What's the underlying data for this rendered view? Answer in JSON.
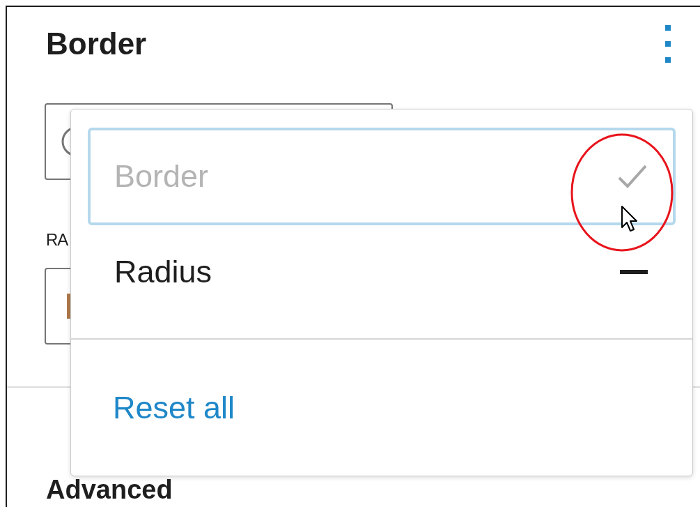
{
  "panel": {
    "title": "Border",
    "fields": [
      {
        "kind": "circle"
      },
      {
        "kind": "swatch"
      }
    ],
    "label": "RA",
    "next_section": "Advanced"
  },
  "menu": {
    "items": [
      {
        "label": "Border",
        "checked": true,
        "disabled": true,
        "focused": true
      },
      {
        "label": "Radius",
        "checked": false,
        "disabled": false,
        "focused": false
      }
    ],
    "reset": "Reset all"
  }
}
